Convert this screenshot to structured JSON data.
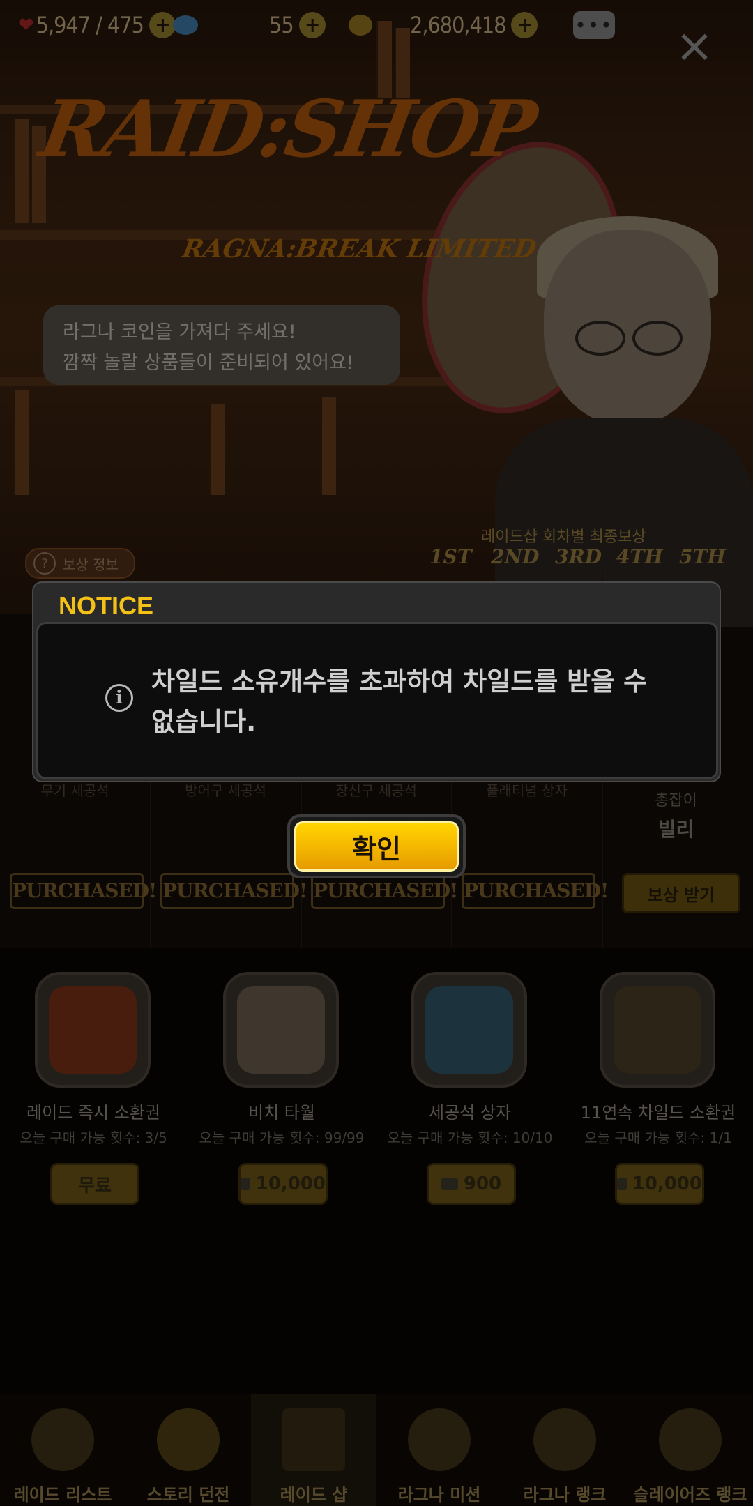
{
  "top_bar": {
    "stamina": "5,947 / 475",
    "gems": "55",
    "gold": "2,680,418"
  },
  "logo": {
    "title": "RAID:SHOP",
    "subtitle": "RAGNA:BREAK LIMITED"
  },
  "speech": {
    "line1": "라그나 코인을 가져다 주세요!",
    "line2": "깜짝 놀랄 상품들이 준비되어 있어요!"
  },
  "rewards": {
    "info_label": "보상 정보",
    "final_title": "레이드샵 회차별 최종보상",
    "ranks": [
      "1ST",
      "2ND",
      "3RD",
      "4TH",
      "5TH"
    ],
    "columns": [
      {
        "label": "무기 세공석",
        "status": "PURCHASED!"
      },
      {
        "label": "방어구 세공석",
        "status": "PURCHASED!"
      },
      {
        "label": "장신구 세공석",
        "status": "PURCHASED!"
      },
      {
        "label": "플래티넘 상자",
        "status": "PURCHASED!"
      }
    ],
    "billy": {
      "line1": "총잡이",
      "line2": "빌리",
      "button": "보상 받기"
    }
  },
  "shop_items": [
    {
      "name": "레이드 즉시 소환권",
      "limit": "오늘 구매 가능 횟수: 3/5",
      "price": "무료",
      "free": true,
      "art": "#6b2a12"
    },
    {
      "name": "비치 타월",
      "limit": "오늘 구매 가능 횟수: 99/99",
      "price": "10,000",
      "free": false,
      "art": "#5a4a3a"
    },
    {
      "name": "세공석 상자",
      "limit": "오늘 구매 가능 횟수: 10/10",
      "price": "900",
      "free": false,
      "art": "#2a4a5a"
    },
    {
      "name": "11연속 차일드 소환권",
      "limit": "오늘 구매 가능 횟수: 1/1",
      "price": "10,000",
      "free": false,
      "art": "#3a3020"
    }
  ],
  "bottom_nav": [
    {
      "label": "레이드 리스트",
      "icon": "boss-raid-icon"
    },
    {
      "label": "스토리 던전",
      "icon": "story-dungeon-icon"
    },
    {
      "label": "레이드 샵",
      "icon": "gift-icon",
      "active": true
    },
    {
      "label": "라그나 미션",
      "icon": "mission-icon"
    },
    {
      "label": "라그나 랭크",
      "icon": "rank-icon"
    },
    {
      "label": "슬레이어즈 랭크",
      "icon": "slayers-rank-icon"
    }
  ],
  "dialog": {
    "title": "NOTICE",
    "message": "차일드 소유개수를 초과하여 차일드를 받을 수 없습니다.",
    "confirm": "확인"
  }
}
